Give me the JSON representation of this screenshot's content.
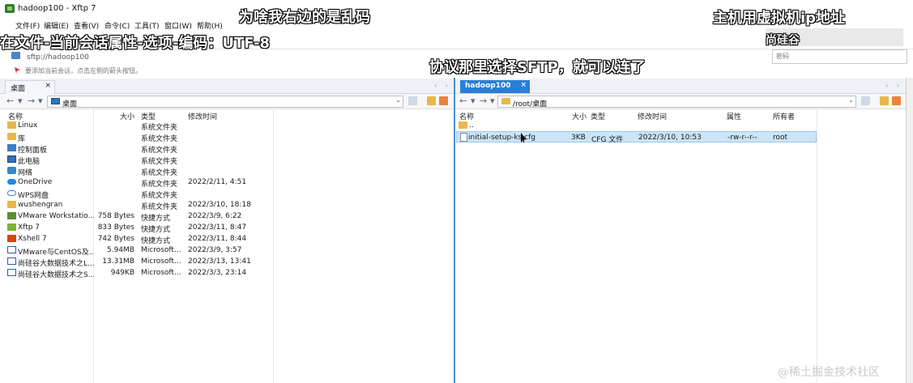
{
  "window": {
    "title": "hadoop100 - Xftp 7"
  },
  "menu": [
    "文件(F)",
    "编辑(E)",
    "查看(V)",
    "命令(C)",
    "工具(T)",
    "窗口(W)",
    "帮助(H)"
  ],
  "address": {
    "value": "sftp://hadoop100",
    "password_placeholder": "密码"
  },
  "hint": {
    "text": "要添加当前会话，点击左侧的箭头按钮。"
  },
  "tabs": {
    "local": {
      "label": "桌面",
      "close": "×"
    },
    "remote": {
      "label": "hadoop100",
      "close": "×"
    },
    "nav": "‹ ›"
  },
  "local": {
    "path": "桌面",
    "columns": {
      "name": "名称",
      "size": "大小",
      "type": "类型",
      "modified": "修改时间"
    },
    "files": [
      {
        "name": "Linux",
        "size": "",
        "type": "系统文件夹",
        "modified": "",
        "icon": "folder-icon"
      },
      {
        "name": "库",
        "size": "",
        "type": "系统文件夹",
        "modified": "",
        "icon": "folder-icon"
      },
      {
        "name": "控制面板",
        "size": "",
        "type": "系统文件夹",
        "modified": "",
        "icon": "control-panel-icon"
      },
      {
        "name": "此电脑",
        "size": "",
        "type": "系统文件夹",
        "modified": "",
        "icon": "computer-icon"
      },
      {
        "name": "网络",
        "size": "",
        "type": "系统文件夹",
        "modified": "",
        "icon": "network-icon"
      },
      {
        "name": "OneDrive",
        "size": "",
        "type": "系统文件夹",
        "modified": "2022/2/11, 4:51",
        "icon": "onedrive-icon"
      },
      {
        "name": "WPS网盘",
        "size": "",
        "type": "系统文件夹",
        "modified": "",
        "icon": "cloud-drive-icon"
      },
      {
        "name": "wushengran",
        "size": "",
        "type": "系统文件夹",
        "modified": "2022/3/10, 18:18",
        "icon": "folder-icon"
      },
      {
        "name": "VMware Workstatio...",
        "size": "758 Bytes",
        "type": "快捷方式",
        "modified": "2022/3/9, 6:22",
        "icon": "vmware-icon"
      },
      {
        "name": "Xftp 7",
        "size": "833 Bytes",
        "type": "快捷方式",
        "modified": "2022/3/11, 8:47",
        "icon": "xftp-icon"
      },
      {
        "name": "Xshell 7",
        "size": "742 Bytes",
        "type": "快捷方式",
        "modified": "2022/3/11, 8:44",
        "icon": "xshell-icon"
      },
      {
        "name": "VMware与CentOS及...",
        "size": "5.94MB",
        "type": "Microsoft...",
        "modified": "2022/3/9, 3:57",
        "icon": "document-icon"
      },
      {
        "name": "尚硅谷大数据技术之L...",
        "size": "13.31MB",
        "type": "Microsoft...",
        "modified": "2022/3/13, 13:41",
        "icon": "document-icon"
      },
      {
        "name": "尚硅谷大数据技术之S...",
        "size": "949KB",
        "type": "Microsoft...",
        "modified": "2022/3/3, 23:14",
        "icon": "document-icon"
      }
    ]
  },
  "remote": {
    "path": "/root/桌面",
    "columns": {
      "name": "名称",
      "size": "大小",
      "type": "类型",
      "modified": "修改时间",
      "attr": "属性",
      "owner": "所有者"
    },
    "files": [
      {
        "name": "..",
        "size": "",
        "type": "",
        "modified": "",
        "attr": "",
        "owner": "",
        "icon": "folder-icon"
      },
      {
        "name": "initial-setup-ks.cfg",
        "size": "3KB",
        "type": "CFG 文件",
        "modified": "2022/3/10, 10:53",
        "attr": "-rw-r--r--",
        "owner": "root",
        "icon": "file-icon"
      }
    ]
  },
  "captions": {
    "top_center": "为啥我右边的是乱码",
    "top_left": "在文件-当前会话属性-选项-编码：UTF-8",
    "top_right": "主机用虚拟机ip地址",
    "middle": "协议那里选择SFTP，就可以连了",
    "top_right_sub": "尚硅谷"
  },
  "watermark": "@稀土掘金技术社区"
}
